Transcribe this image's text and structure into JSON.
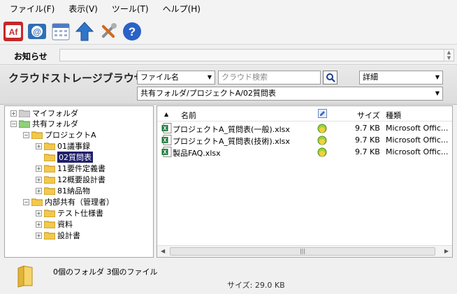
{
  "menu": [
    {
      "label": "ファイル(F)"
    },
    {
      "label": "表示(V)"
    },
    {
      "label": "ツール(T)"
    },
    {
      "label": "ヘルプ(H)"
    }
  ],
  "toolbar": {
    "icons": [
      "acrobat-icon",
      "mail-icon",
      "calendar-icon",
      "upload-icon",
      "tools-icon",
      "help-icon"
    ]
  },
  "notice": {
    "label": "お知らせ"
  },
  "storage": {
    "title": "クラウドストレージブラウザ",
    "field_select": "ファイル名",
    "search_placeholder": "クラウド検索",
    "view_select": "詳細",
    "path": "共有フォルダ/プロジェクトA/02質問表"
  },
  "tree": {
    "my_folder": "マイフォルダ",
    "shared": "共有フォルダ",
    "project": "プロジェクトA",
    "project_children": [
      "01議事録",
      "02質問表",
      "11要件定義書",
      "12概要設計書",
      "81納品物"
    ],
    "internal": "内部共有（管理者）",
    "internal_children": [
      "テスト仕様書",
      "資料",
      "設計書"
    ]
  },
  "files": {
    "col_name": "名前",
    "col_size": "サイズ",
    "col_type": "種類",
    "rows": [
      {
        "name": "プロジェクトA_質問表(一般).xlsx",
        "size": "9.7 KB",
        "type": "Microsoft Offic..."
      },
      {
        "name": "プロジェクトA_質問表(技術).xlsx",
        "size": "9.7 KB",
        "type": "Microsoft Offic..."
      },
      {
        "name": "製品FAQ.xlsx",
        "size": "9.7 KB",
        "type": "Microsoft Offic..."
      }
    ]
  },
  "status": {
    "counts": "0個のフォルダ 3個のファイル",
    "size": "サイズ: 29.0 KB"
  },
  "colors": {
    "accent": "#2d5fb3",
    "selection": "#1f1f6a",
    "folder": "#f2c94c"
  }
}
